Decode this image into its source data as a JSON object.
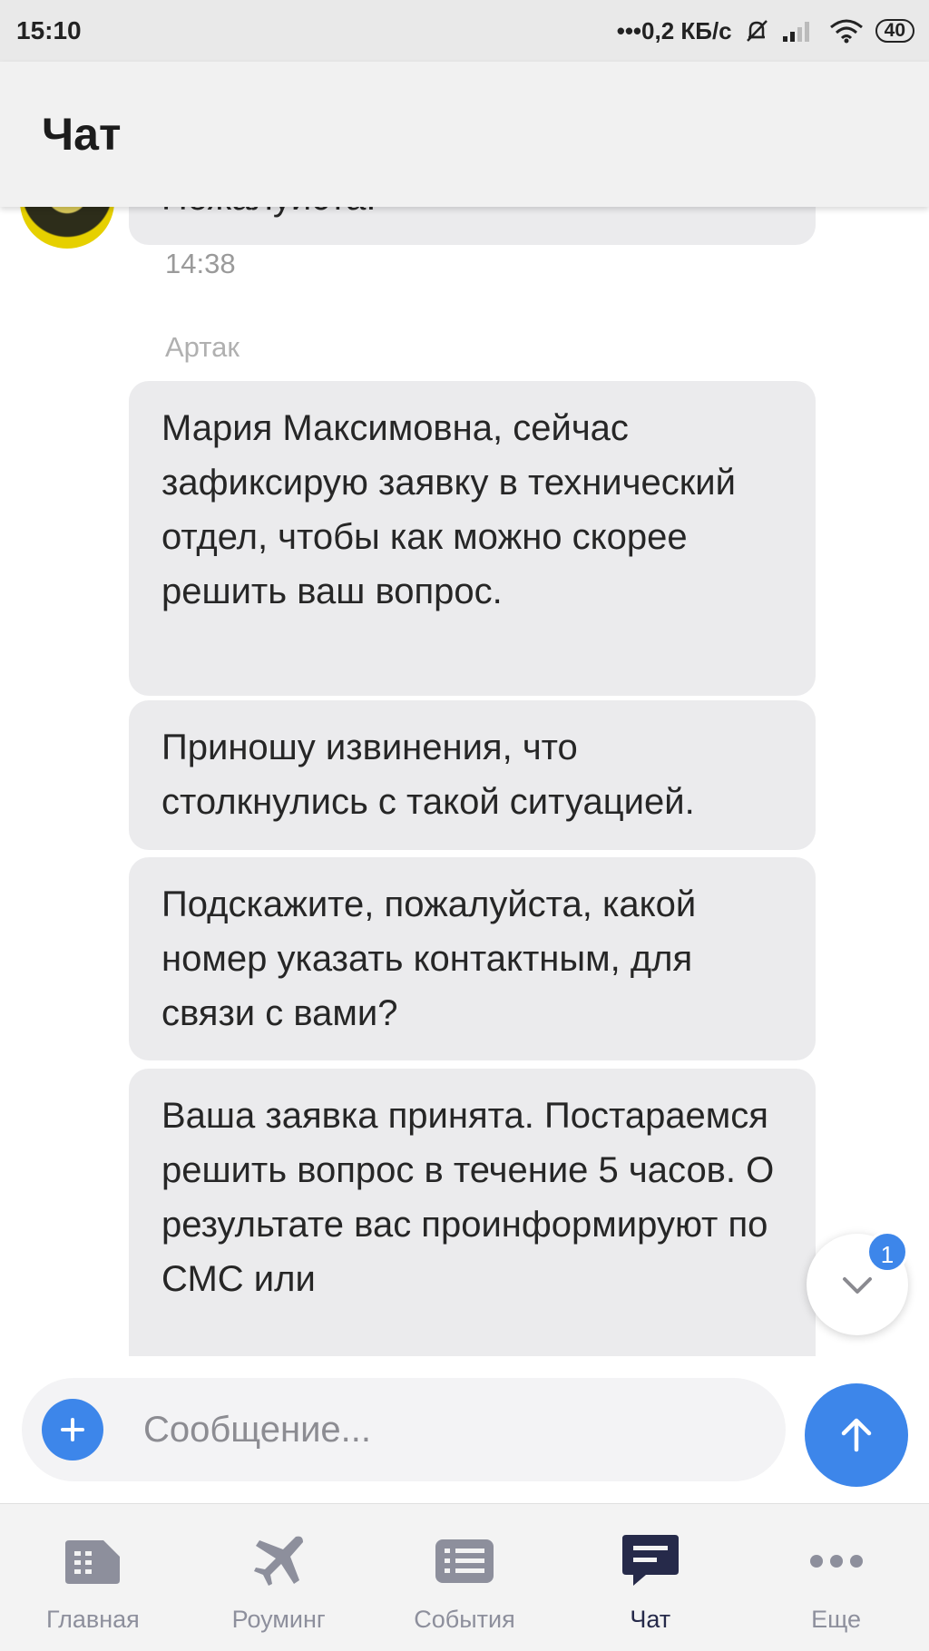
{
  "status_bar": {
    "time": "15:10",
    "network_speed": "•••0,2 КБ/с",
    "battery": "40",
    "icons": [
      "mute-icon",
      "signal-icon",
      "wifi-icon",
      "battery-icon"
    ]
  },
  "header": {
    "title": "Чат"
  },
  "chat": {
    "partial_message": "Пожалуйста.",
    "partial_message_time": "14:38",
    "sender": "Артак",
    "messages": [
      "Мария Максимовна, сейчас зафиксирую заявку в технический отдел, чтобы как можно скорее решить ваш вопрос.",
      "Приношу извинения, что столкнулись с такой ситуацией.",
      "Подскажите, пожалуйста, какой номер указать контактным, для связи с вами?",
      "Ваша заявка принята. Постараемся решить вопрос в течение 5 часов. О результате вас проинформируют по СМС или"
    ],
    "unread_count": "1"
  },
  "composer": {
    "placeholder": "Сообщение..."
  },
  "bottom_nav": {
    "items": [
      {
        "label": "Главная",
        "icon": "home-card-icon"
      },
      {
        "label": "Роуминг",
        "icon": "airplane-icon"
      },
      {
        "label": "События",
        "icon": "events-list-icon"
      },
      {
        "label": "Чат",
        "icon": "chat-icon",
        "active": true
      },
      {
        "label": "Еще",
        "icon": "more-dots-icon"
      }
    ]
  },
  "colors": {
    "accent": "#3d86ea",
    "bubble": "#ebebed",
    "nav_active": "#262a4a",
    "nav_inactive": "#8d8f9c"
  }
}
